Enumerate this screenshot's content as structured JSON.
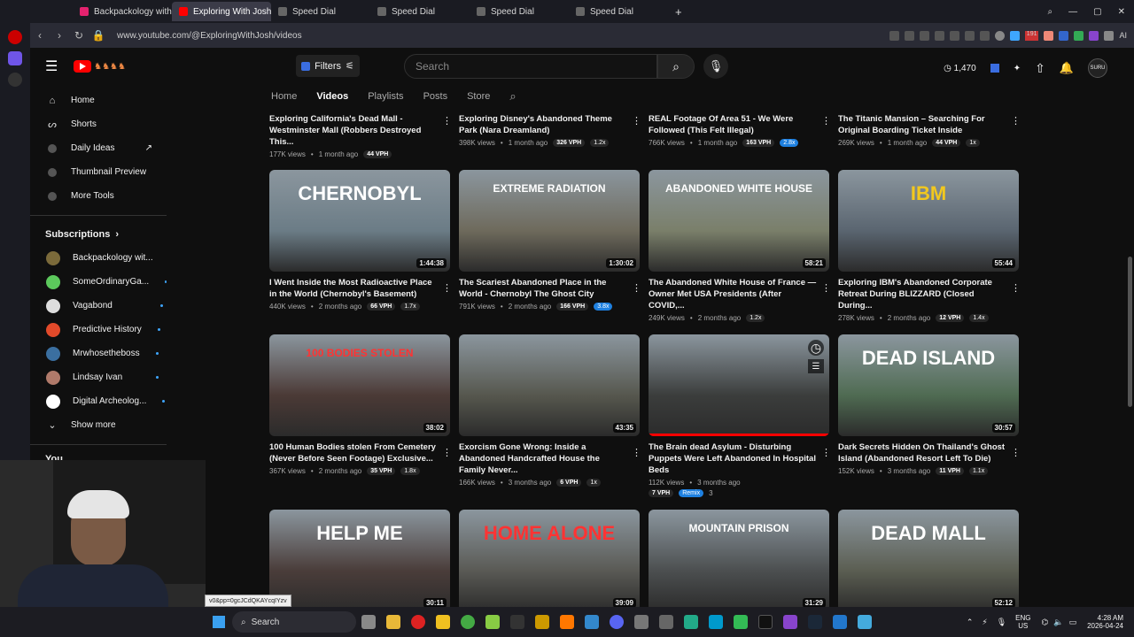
{
  "browser": {
    "tabs": [
      {
        "label": "Backpackology with Steve",
        "color": "#e4226e"
      },
      {
        "label": "Exploring With Josh - You",
        "color": "#ff0000",
        "active": true
      },
      {
        "label": "Speed Dial",
        "color": "#777"
      },
      {
        "label": "Speed Dial",
        "color": "#777"
      },
      {
        "label": "Speed Dial",
        "color": "#777"
      },
      {
        "label": "Speed Dial",
        "color": "#777"
      }
    ],
    "url": "www.youtube.com/@ExploringWithJosh/videos",
    "ext_badge": "191"
  },
  "header": {
    "filters_label": "Filters",
    "search_placeholder": "Search",
    "counter": "1,470",
    "avatar_text": "SURU"
  },
  "sidebar": {
    "items": [
      {
        "label": "Home",
        "icon": "home-icon"
      },
      {
        "label": "Shorts",
        "icon": "shorts-icon"
      },
      {
        "label": "Daily Ideas",
        "icon": "idea-icon"
      },
      {
        "label": "Thumbnail Preview",
        "icon": "thumbnail-icon"
      },
      {
        "label": "More Tools",
        "icon": "tools-icon"
      }
    ],
    "subscriptions_title": "Subscriptions",
    "subscriptions": [
      {
        "name": "Backpackology wit...",
        "color": "#7b6a3a",
        "dot": false
      },
      {
        "name": "SomeOrdinaryGa...",
        "color": "#5cc95c",
        "dot": true
      },
      {
        "name": "Vagabond",
        "color": "#ddd",
        "dot": true
      },
      {
        "name": "Predictive History",
        "color": "#e24a2a",
        "dot": true
      },
      {
        "name": "Mrwhosetheboss",
        "color": "#3b6fa0",
        "dot": true
      },
      {
        "name": "Lindsay Ivan",
        "color": "#b07a6a",
        "dot": true
      },
      {
        "name": "Digital Archeolog...",
        "color": "#fff",
        "dot": true
      }
    ],
    "show_more": "Show more",
    "you_label": "You"
  },
  "channel_tabs": [
    "Home",
    "Videos",
    "Playlists",
    "Posts",
    "Store"
  ],
  "videos": [
    {
      "title": "Exploring California's Dead Mall - Westminster Mall (Robbers Destroyed This...",
      "views": "177K views",
      "age": "1 month ago",
      "vph": "44 VPH",
      "mult": "",
      "duration": "",
      "hi": false
    },
    {
      "title": "Exploring Disney's Abandoned Theme Park (Nara Dreamland)",
      "views": "398K views",
      "age": "1 month ago",
      "vph": "326 VPH",
      "mult": "1.2x",
      "duration": "",
      "hi": false
    },
    {
      "title": "REAL Footage Of Area 51 - We Were Followed (This Felt Illegal)",
      "views": "766K views",
      "age": "1 month ago",
      "vph": "163 VPH",
      "mult": "2.8x",
      "duration": "",
      "hi": true
    },
    {
      "title": "The Titanic Mansion – Searching For Original Boarding Ticket Inside",
      "views": "269K views",
      "age": "1 month ago",
      "vph": "44 VPH",
      "mult": "1x",
      "duration": "",
      "hi": false
    },
    {
      "title": "I Went Inside the Most Radioactive Place in the World (Chernobyl's Basement)",
      "views": "440K views",
      "age": "2 months ago",
      "vph": "66 VPH",
      "mult": "1.7x",
      "duration": "1:44:38",
      "hi": false,
      "thumb_text": "CHERNOBYL",
      "bg": "#6b7c86"
    },
    {
      "title": "The Scariest Abandoned Place in the World - Chernobyl The Ghost City",
      "views": "791K views",
      "age": "2 months ago",
      "vph": "166 VPH",
      "mult": "3.8x",
      "duration": "1:30:02",
      "hi": true,
      "thumb_text": "EXTREME RADIATION",
      "bg": "#6e6a5c"
    },
    {
      "title": "The Abandoned White House of France — Owner Met USA Presidents (After COVID,...",
      "views": "249K views",
      "age": "2 months ago",
      "vph": "",
      "mult": "1.2x",
      "duration": "58:21",
      "hi": false,
      "thumb_text": "ABANDONED WHITE HOUSE",
      "bg": "#7a7f6a"
    },
    {
      "title": "Exploring IBM's Abandoned Corporate Retreat During BLIZZARD (Closed During...",
      "views": "278K views",
      "age": "2 months ago",
      "vph": "12 VPH",
      "mult": "1.4x",
      "duration": "55:44",
      "hi": false,
      "thumb_text": "IBM",
      "bg": "#5a6570"
    },
    {
      "title": "100 Human Bodies stolen From Cemetery (Never Before Seen Footage) Exclusive...",
      "views": "367K views",
      "age": "2 months ago",
      "vph": "35 VPH",
      "mult": "1.8x",
      "duration": "38:02",
      "hi": false,
      "thumb_text": "100 BODIES STOLEN",
      "bg": "#4b3a36"
    },
    {
      "title": "Exorcism Gone Wrong: Inside a Abandoned Handcrafted House the Family Never...",
      "views": "166K views",
      "age": "3 months ago",
      "vph": "6 VPH",
      "mult": "1x",
      "duration": "43:35",
      "hi": false,
      "thumb_text": "",
      "bg": "#56574e"
    },
    {
      "title": "The Brain dead Asylum - Disturbing Puppets Were Left Abandoned In Hospital Beds",
      "views": "112K views",
      "age": "3 months ago",
      "vph": "7 VPH",
      "mult": "",
      "duration": "",
      "hi": false,
      "thumb_text": "",
      "bg": "#3b3d3c",
      "remix": "Remix",
      "remix_count": "3",
      "progress": 1.0
    },
    {
      "title": "Dark Secrets Hidden On Thailand's Ghost Island (Abandoned Resort Left To Die)",
      "views": "152K views",
      "age": "3 months ago",
      "vph": "11 VPH",
      "mult": "1.1x",
      "duration": "30:57",
      "hi": false,
      "thumb_text": "DEAD ISLAND",
      "bg": "#4f6b52"
    },
    {
      "title": "",
      "duration": "30:11",
      "thumb_text": "HELP ME",
      "bg": "#4a3d3a"
    },
    {
      "title": "",
      "duration": "39:09",
      "thumb_text": "HOME ALONE",
      "bg": "#5a5a55"
    },
    {
      "title": "",
      "duration": "31:29",
      "thumb_text": "MOUNTAIN PRISON",
      "bg": "#4c4f50"
    },
    {
      "title": "",
      "duration": "52:12",
      "thumb_text": "DEAD MALL",
      "bg": "#5b5e52"
    }
  ],
  "tooltip": "v0&pp=0gcJCdQKAYcqIYzv",
  "taskbar": {
    "search": "Search",
    "lang": "ENG",
    "region": "US",
    "time": "4:28 AM",
    "date": "2026-04-24"
  }
}
